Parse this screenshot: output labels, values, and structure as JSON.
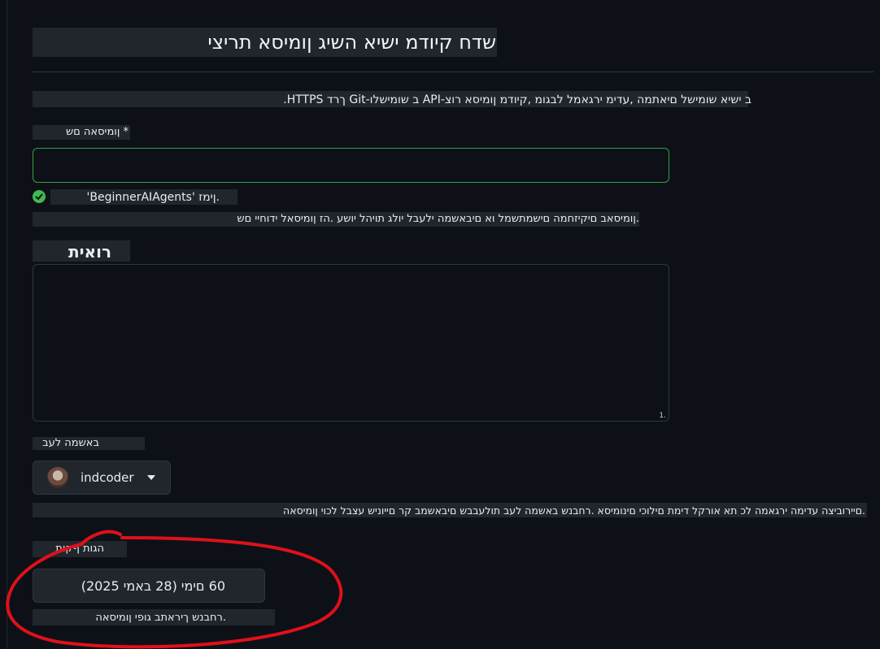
{
  "page": {
    "title": "שדח קיודמ ישיא השיג ןומיסא תריצי",
    "intro": "ב ישיא שומישל םיאתמה ,עדימ ירגאמל לבגומ ,קיודמ ןומיסא רוצ-API ב שומישלו-Git ךרד HTTPS."
  },
  "form": {
    "name": {
      "label": "* ןומיסאה םש",
      "value": "",
      "status_text": ".ןימז 'BeginnerAIAgents'",
      "help": ".ןומיסאב םיקיזחמה םישמתשמל וא םיבאשמה ילעבל יולג תויהל יושע .הז ןומיסאל ידוחיי םש"
    },
    "description": {
      "label": "רואית",
      "value": "",
      "resize_glyph": "1."
    },
    "owner": {
      "label": "באשמה לעב",
      "value": "indcoder",
      "help": ".םיירוביצה עדימה ירגאמה לכ תא אורקל דימת םילוכי םינומיסא .רחבנש באשמה לעב תולעבבש םיבאשמב קר םייוניש עצבל לכוי ןומיסאה"
    },
    "expiration": {
      "label": "הגות ףקות",
      "value": "60 םימי (28 באמי 2025)",
      "help": ".רחבנש ךיראתב גופי ןומיסאה"
    }
  },
  "colors": {
    "background": "#0d1117",
    "success": "#3fb950",
    "annotation": "#e0101a"
  },
  "icons": {
    "status": "check-circle-icon",
    "owner_avatar": "avatar",
    "dropdown": "caret-down-icon"
  }
}
